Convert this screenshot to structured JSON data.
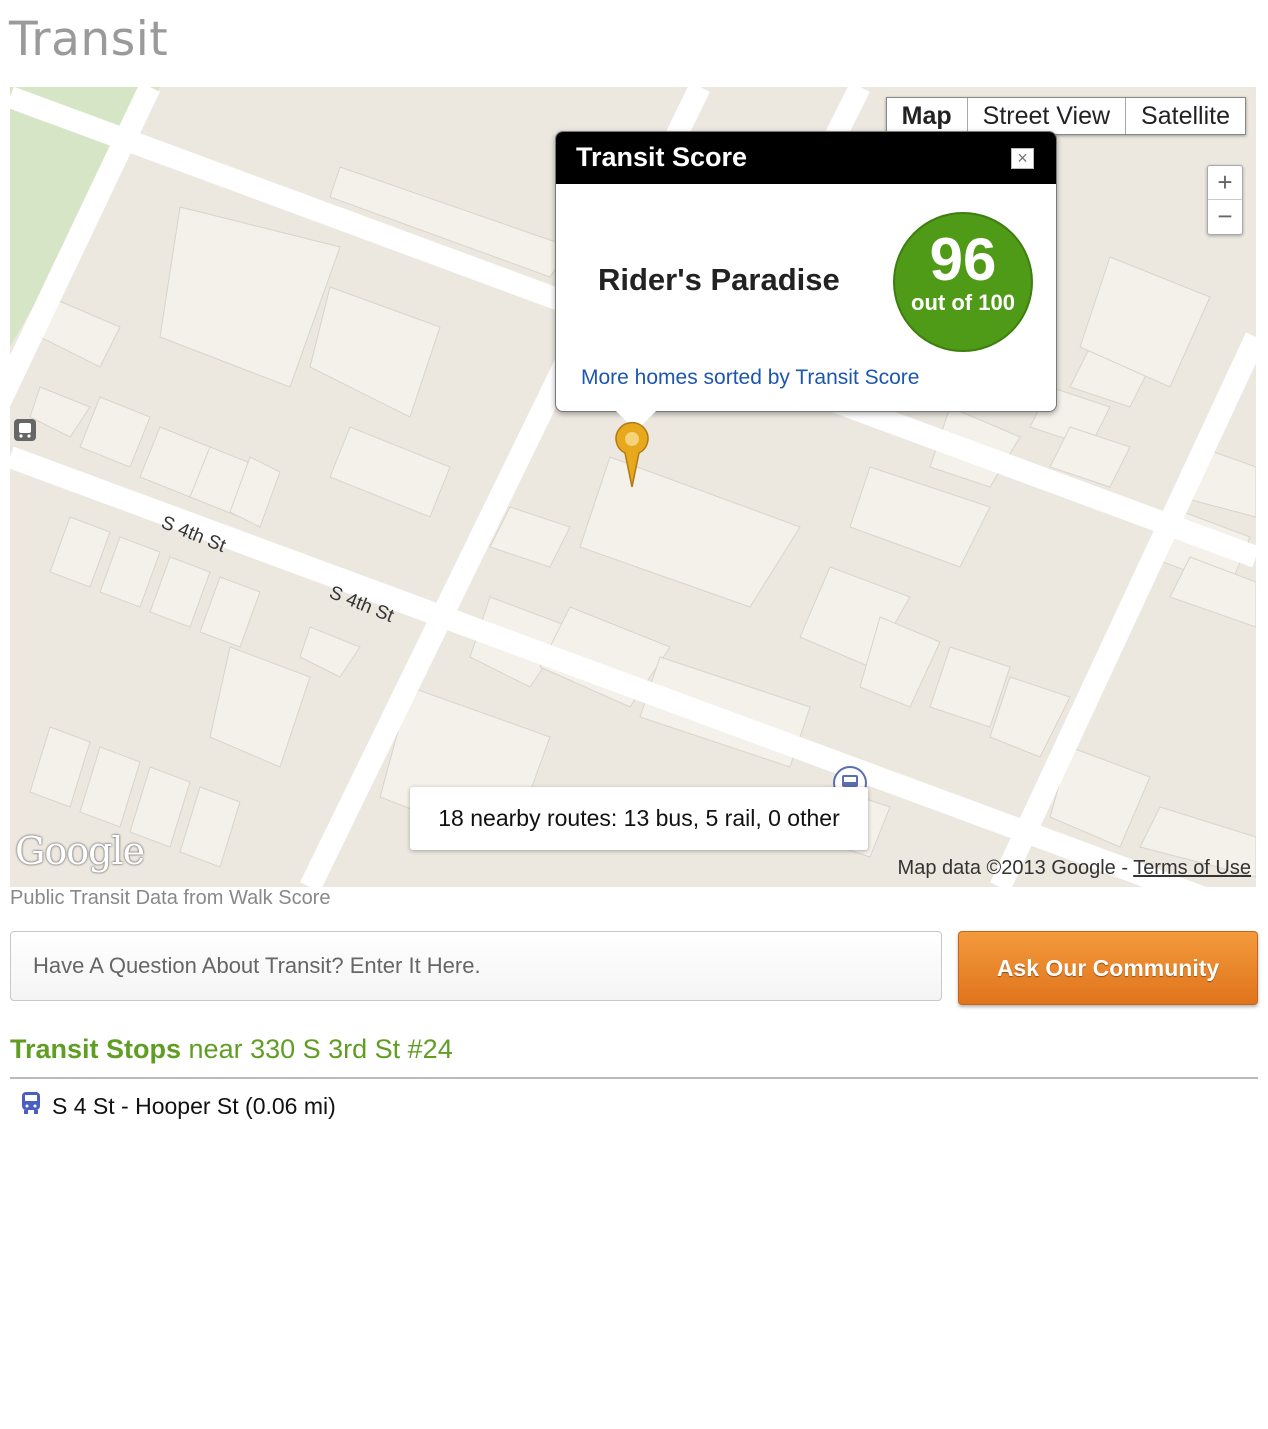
{
  "page": {
    "title": "Transit"
  },
  "map": {
    "type_buttons": [
      "Map",
      "Street View",
      "Satellite"
    ],
    "zoom_in": "+",
    "zoom_out": "−",
    "street_labels": [
      "S 4th St",
      "S 4th St"
    ],
    "popup": {
      "title": "Transit Score",
      "close": "×",
      "label": "Rider's Paradise",
      "score": "96",
      "out_of": "out of 100",
      "link": "More homes sorted by Transit Score"
    },
    "routes_summary": "18 nearby routes: 13 bus, 5 rail, 0 other",
    "logo_text": "Google",
    "attribution": "Map data ©2013 Google - ",
    "terms": "Terms of Use",
    "colors": {
      "score_green": "#4f9a16",
      "link_blue": "#1d56b0",
      "pin_yellow": "#e8a81d"
    }
  },
  "credit": "Public Transit Data from Walk Score",
  "ask": {
    "placeholder": "Have A Question About Transit? Enter It Here.",
    "button": "Ask Our Community"
  },
  "stops": {
    "heading_bold": "Transit Stops",
    "heading_rest": " near 330 S 3rd St #24",
    "items": [
      {
        "icon": "bus-icon",
        "label": "S 4 St - Hooper St (0.06 mi)"
      }
    ]
  }
}
